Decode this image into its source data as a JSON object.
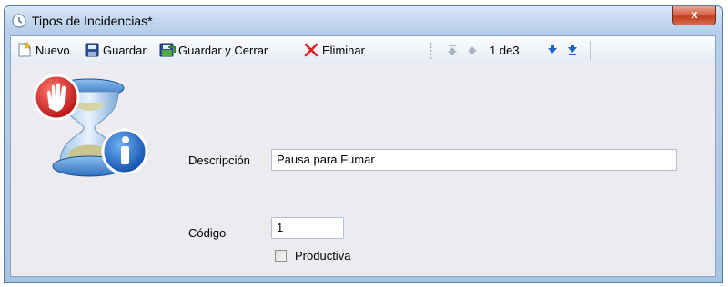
{
  "window": {
    "title": "Tipos de Incidencias*",
    "close_label": "x"
  },
  "toolbar": {
    "nuevo": "Nuevo",
    "guardar": "Guardar",
    "guardar_cerrar": "Guardar y Cerrar",
    "eliminar": "Eliminar",
    "record_position": "1 de3"
  },
  "form": {
    "descripcion_label": "Descripción",
    "descripcion_value": "Pausa para Fumar",
    "codigo_label": "Código",
    "codigo_value": "1",
    "productiva_label": "Productiva",
    "productiva_checked": false
  },
  "colors": {
    "close_button": "#c13d22",
    "eliminar_icon": "#e01b1b",
    "nav_arrow_active": "#1e63c8"
  }
}
